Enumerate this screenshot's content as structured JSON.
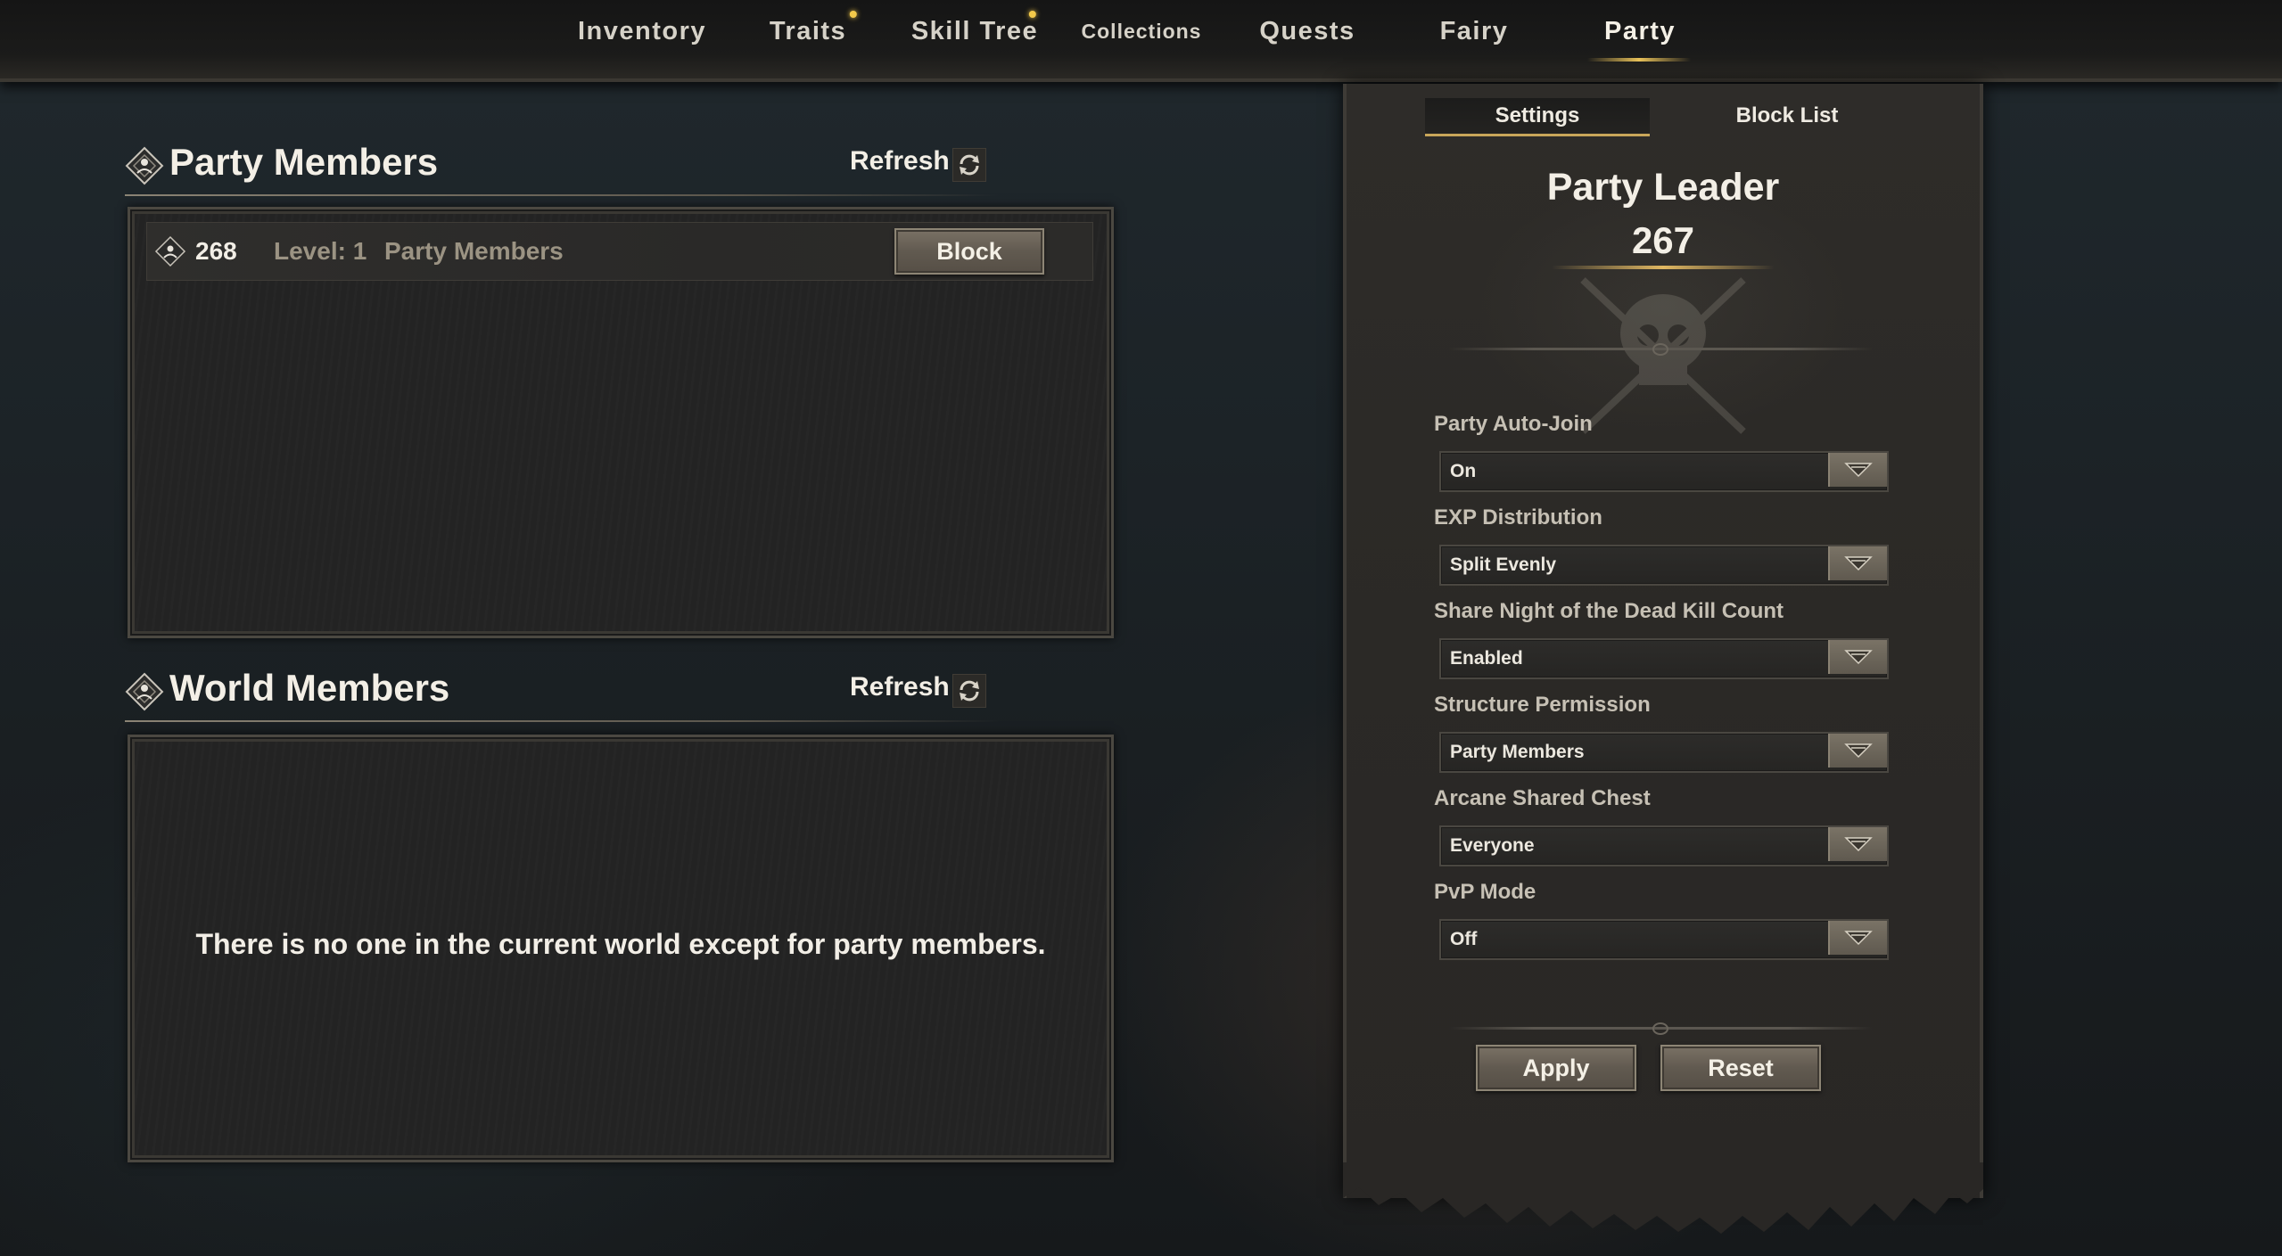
{
  "nav": {
    "tabs": [
      {
        "label": "Inventory"
      },
      {
        "label": "Traits"
      },
      {
        "label": "Skill Tree"
      },
      {
        "label": "Collections"
      },
      {
        "label": "Quests"
      },
      {
        "label": "Fairy"
      },
      {
        "label": "Party"
      }
    ],
    "active_tab": "Party",
    "notification_dots": [
      "Traits",
      "Skill Tree"
    ]
  },
  "party_members": {
    "title": "Party Members",
    "refresh_label": "Refresh",
    "members": [
      {
        "id": "268",
        "level": "Level: 1",
        "role": "Party Members",
        "action": "Block"
      }
    ]
  },
  "world_members": {
    "title": "World Members",
    "refresh_label": "Refresh",
    "empty_message": "There is no one in the current world except for party members."
  },
  "settings_panel": {
    "tabs": [
      {
        "label": "Settings"
      },
      {
        "label": "Block List"
      }
    ],
    "active_tab": "Settings",
    "leader_title": "Party Leader",
    "leader_id": "267",
    "fields": [
      {
        "label": "Party Auto-Join",
        "value": "On"
      },
      {
        "label": "EXP Distribution",
        "value": "Split Evenly"
      },
      {
        "label": "Share Night of the Dead Kill Count",
        "value": "Enabled"
      },
      {
        "label": "Structure Permission",
        "value": "Party Members"
      },
      {
        "label": "Arcane Shared Chest",
        "value": "Everyone"
      },
      {
        "label": "PvP Mode",
        "value": "Off"
      }
    ],
    "apply_label": "Apply",
    "reset_label": "Reset"
  },
  "colors": {
    "accent_gold": "#e1b862",
    "notification_dot": "#f3c94a"
  }
}
